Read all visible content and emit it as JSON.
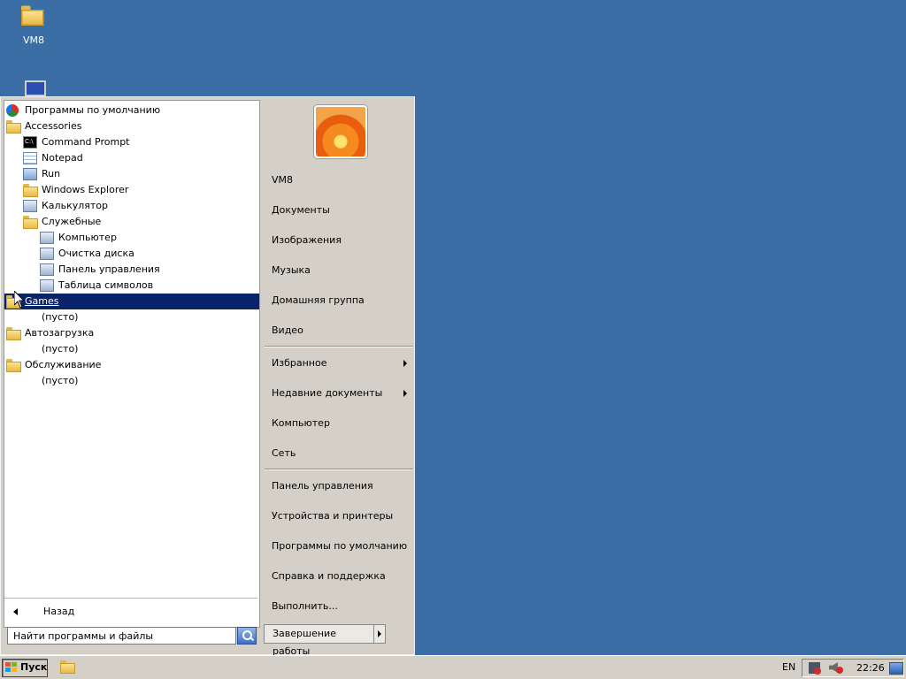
{
  "desktop": {
    "icons": [
      {
        "label": "VM8",
        "icon": "user-folder-icon"
      },
      {
        "label": "",
        "icon": "computer-icon"
      }
    ]
  },
  "start_menu": {
    "programs": [
      {
        "label": "Программы по умолчанию",
        "icon": "default-programs-icon",
        "indent": 0
      },
      {
        "label": "Accessories",
        "icon": "folder-icon",
        "indent": 0
      },
      {
        "label": "Command Prompt",
        "icon": "cmd-icon",
        "indent": 1
      },
      {
        "label": "Notepad",
        "icon": "notepad-icon",
        "indent": 1
      },
      {
        "label": "Run",
        "icon": "run-icon",
        "indent": 1
      },
      {
        "label": "Windows Explorer",
        "icon": "explorer-icon",
        "indent": 1
      },
      {
        "label": "Калькулятор",
        "icon": "calculator-icon",
        "indent": 1
      },
      {
        "label": "Служебные",
        "icon": "folder-icon",
        "indent": 1
      },
      {
        "label": "Компьютер",
        "icon": "computer-icon",
        "indent": 2
      },
      {
        "label": "Очистка диска",
        "icon": "disk-cleanup-icon",
        "indent": 2
      },
      {
        "label": "Панель управления",
        "icon": "control-panel-icon",
        "indent": 2
      },
      {
        "label": "Таблица символов",
        "icon": "charmap-icon",
        "indent": 2
      },
      {
        "label": "Games",
        "icon": "folder-icon",
        "indent": 0,
        "selected": true
      },
      {
        "label": "(пусто)",
        "icon": "",
        "indent": 1
      },
      {
        "label": "Автозагрузка",
        "icon": "folder-icon",
        "indent": 0
      },
      {
        "label": "(пусто)",
        "icon": "",
        "indent": 1
      },
      {
        "label": "Обслуживание",
        "icon": "folder-icon",
        "indent": 0
      },
      {
        "label": "(пусто)",
        "icon": "",
        "indent": 1
      }
    ],
    "back_label": "Назад",
    "search_placeholder": "Найти программы и файлы",
    "right_items": [
      {
        "label": "VM8"
      },
      {
        "label": "Документы"
      },
      {
        "label": "Изображения"
      },
      {
        "label": "Музыка"
      },
      {
        "label": "Домашняя группа"
      },
      {
        "label": "Видео"
      },
      {
        "label": "Избранное",
        "submenu": true
      },
      {
        "label": "Недавние документы",
        "submenu": true
      },
      {
        "label": "Компьютер"
      },
      {
        "label": "Сеть"
      },
      {
        "label": "Панель управления"
      },
      {
        "label": "Устройства и принтеры"
      },
      {
        "label": "Программы по умолчанию"
      },
      {
        "label": "Справка и поддержка"
      },
      {
        "label": "Выполнить..."
      }
    ],
    "shutdown_label": "Завершение работы"
  },
  "taskbar": {
    "start_label": "Пуск",
    "lang": "EN",
    "clock": "22:26"
  }
}
